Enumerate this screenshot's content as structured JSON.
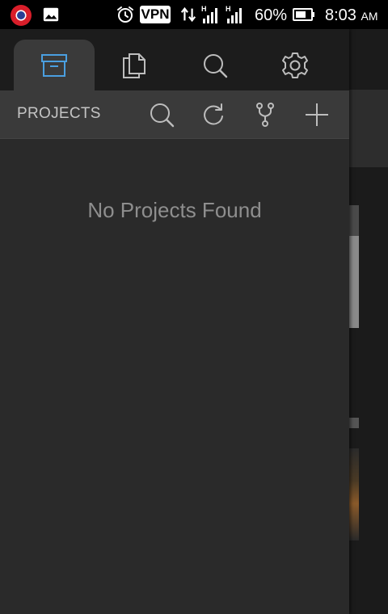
{
  "status_bar": {
    "vpn_label": "VPN",
    "battery_percent": "60%",
    "time": "8:03",
    "am_pm": "AM",
    "icons": [
      "flag-app-icon",
      "gallery-icon",
      "alarm-icon",
      "data-arrows-icon",
      "signal-h-icon",
      "signal-h-icon",
      "battery-icon"
    ]
  },
  "drawer": {
    "tabs": [
      {
        "name": "projects",
        "icon": "archive-box-icon",
        "active": true
      },
      {
        "name": "files",
        "icon": "documents-icon",
        "active": false
      },
      {
        "name": "search",
        "icon": "search-icon",
        "active": false
      },
      {
        "name": "settings",
        "icon": "gear-icon",
        "active": false
      }
    ],
    "header": {
      "title": "PROJECTS",
      "actions": [
        "search-icon",
        "refresh-icon",
        "git-fork-icon",
        "plus-icon"
      ]
    },
    "empty_message": "No Projects Found"
  },
  "colors": {
    "accent": "#4a9fe0",
    "icon": "#bdbdbd",
    "drawer_bg": "#2a2a2a",
    "header_bg": "#3a3a3a",
    "tabs_bg": "#1c1c1c"
  }
}
